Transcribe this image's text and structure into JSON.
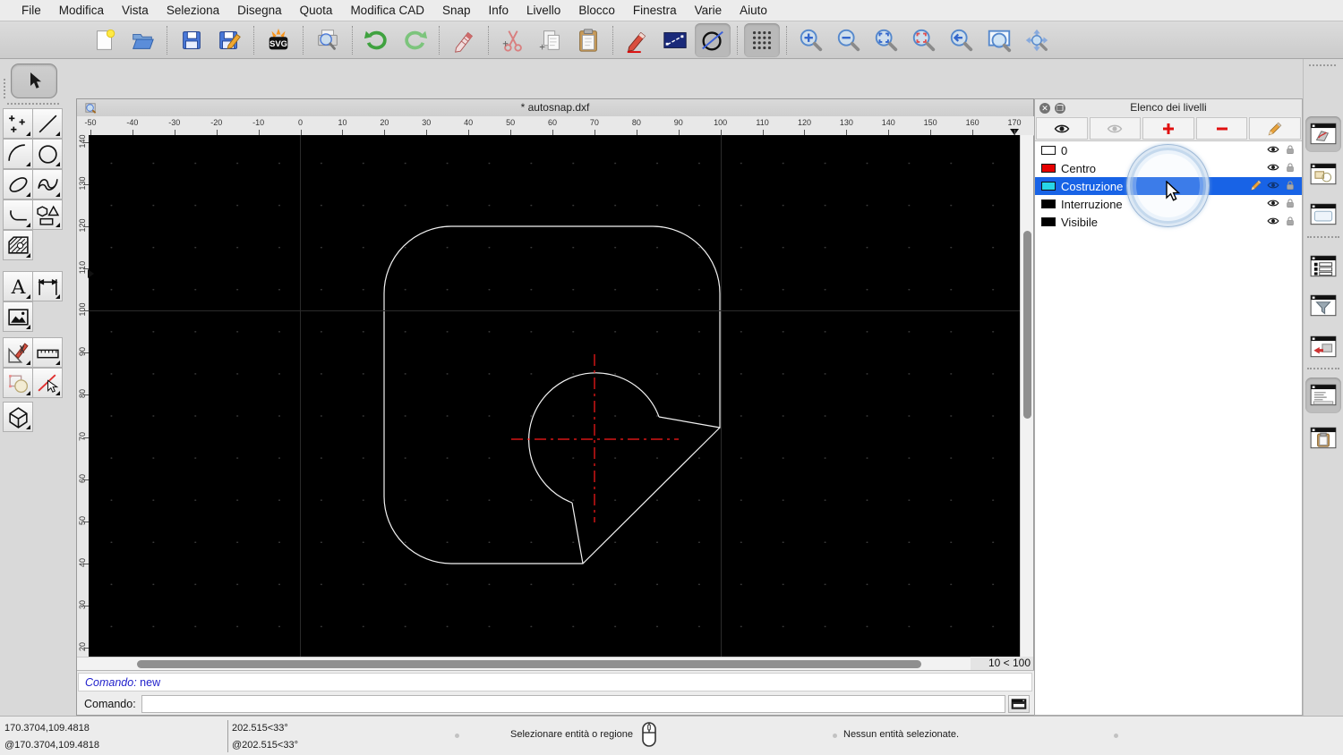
{
  "menu_bar": {
    "items": [
      "File",
      "Modifica",
      "Vista",
      "Seleziona",
      "Disegna",
      "Quota",
      "Modifica CAD",
      "Snap",
      "Info",
      "Livello",
      "Blocco",
      "Finestra",
      "Varie",
      "Aiuto"
    ]
  },
  "main_toolbar": {
    "groups": [
      [
        {
          "n": "new-document"
        },
        {
          "n": "open"
        }
      ],
      [
        {
          "n": "save"
        },
        {
          "n": "save-as"
        }
      ],
      [
        {
          "n": "svg-export"
        }
      ],
      [
        {
          "n": "print-preview"
        }
      ],
      [
        {
          "n": "undo"
        },
        {
          "n": "redo"
        }
      ],
      [
        {
          "n": "delete"
        }
      ],
      [
        {
          "n": "cut"
        },
        {
          "n": "copy"
        },
        {
          "n": "paste"
        }
      ],
      [
        {
          "n": "pen-attributes"
        },
        {
          "n": "line-attributes"
        },
        {
          "n": "draft-mode",
          "pressed": true
        }
      ],
      [
        {
          "n": "grid",
          "pressed": true
        }
      ],
      [
        {
          "n": "zoom-in"
        },
        {
          "n": "zoom-out"
        },
        {
          "n": "zoom-auto"
        },
        {
          "n": "zoom-selected"
        },
        {
          "n": "zoom-previous"
        },
        {
          "n": "zoom-window"
        },
        {
          "n": "zoom-pan"
        }
      ]
    ]
  },
  "left_toolbar": {
    "select_tool": "select",
    "tools": [
      "points",
      "line",
      "arc",
      "circle",
      "ellipse",
      "spline",
      "polyline",
      "polygon",
      "hatch",
      "text",
      "dimension",
      "image",
      "modify",
      "measure",
      "select-entities",
      "explode",
      "solid-3d"
    ]
  },
  "drawing_window": {
    "title": "* autosnap.dxf",
    "grid_status": "10 < 100",
    "h_ruler": [
      "-50",
      "-40",
      "-30",
      "-20",
      "-10",
      "0",
      "10",
      "20",
      "30",
      "40",
      "50",
      "60",
      "70",
      "80",
      "90",
      "100",
      "110",
      "120",
      "130",
      "140",
      "150",
      "160",
      "170"
    ],
    "v_ruler": [
      "140",
      "130",
      "120",
      "110",
      "100",
      "90",
      "80",
      "70",
      "60",
      "50",
      "40",
      "30",
      "20"
    ]
  },
  "layer_list": {
    "title": "Elenco dei livelli",
    "toolbar_icons": [
      "show-all-layers-eye",
      "hide-all-layers-eye",
      "add-layer-plus",
      "remove-layer-minus",
      "edit-layer-pencil"
    ],
    "layers": [
      {
        "name": "0",
        "color": "#ffffff",
        "selected": false
      },
      {
        "name": "Centro",
        "color": "#e60000",
        "selected": false
      },
      {
        "name": "Costruzione",
        "color": "#27d5e8",
        "selected": true
      },
      {
        "name": "Interruzione",
        "color": "#000000",
        "selected": false
      },
      {
        "name": "Visibile",
        "color": "#000000",
        "selected": false
      }
    ]
  },
  "right_dock": {
    "buttons": [
      {
        "n": "window-sketch",
        "pressed": true
      },
      {
        "n": "window-shapes"
      },
      {
        "n": "window-blank"
      },
      {
        "n": "window-list"
      },
      {
        "n": "window-filter"
      },
      {
        "n": "window-arrow-box"
      },
      {
        "n": "window-command",
        "pressed": true
      },
      {
        "n": "window-clipboard"
      }
    ]
  },
  "command_dock": {
    "history_label": "Comando:",
    "history_value": "new",
    "prompt_label": "Comando:",
    "input_value": ""
  },
  "status_bar": {
    "abs_coord": "170.3704,109.4818",
    "rel_coord": "@170.3704,109.4818",
    "abs_polar": "202.515<33°",
    "rel_polar": "@202.515<33°",
    "hint": "Selezionare entità o regione",
    "selection_status": "Nessun entità selezionate."
  },
  "colors": {
    "selection_blue": "#1863e6",
    "canvas_bg": "#000000",
    "centerline_red": "#ff0000",
    "entity_white": "#f2f2f2",
    "layer_cyan": "#27d5e8",
    "layer_red": "#e60000"
  }
}
